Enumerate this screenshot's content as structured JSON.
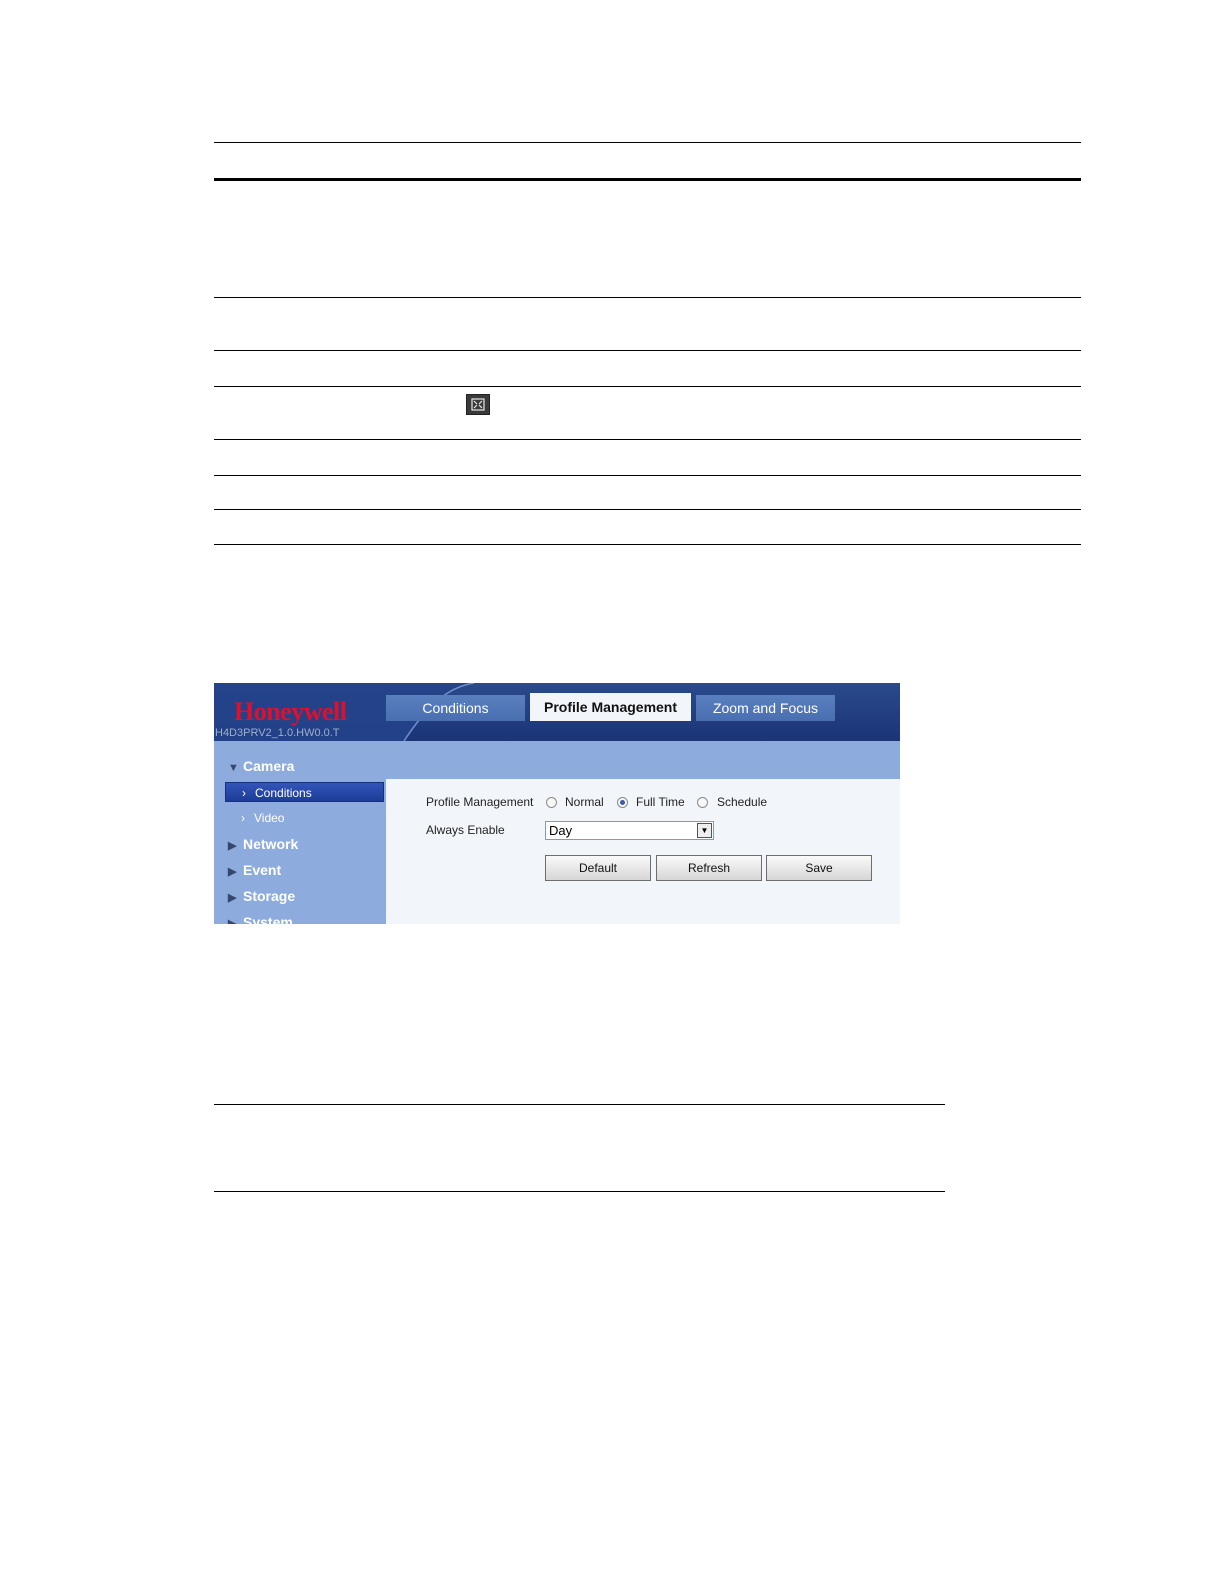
{
  "ui": {
    "logo": "Honeywell",
    "firmware": "H4D3PRV2_1.0.HW0.0.T",
    "nav": {
      "camera": "Camera",
      "conditions": "Conditions",
      "video": "Video",
      "network": "Network",
      "event": "Event",
      "storage": "Storage",
      "system": "System"
    },
    "tabs": [
      "Conditions",
      "Profile Management",
      "Zoom and Focus"
    ],
    "form": {
      "profile_label": "Profile Management",
      "radio_options": [
        "Normal",
        "Full Time",
        "Schedule"
      ],
      "selected_option": "Full Time",
      "always_enable_label": "Always Enable",
      "always_enable_value": "Day"
    },
    "buttons": {
      "default": "Default",
      "refresh": "Refresh",
      "save": "Save"
    }
  },
  "icons": {
    "table_icon": "fullscreen-icon"
  },
  "colors": {
    "banner": "#1b3577",
    "sidebar": "#8dabdd",
    "logo": "#e0102a",
    "active_nav": "#1d3c98"
  }
}
